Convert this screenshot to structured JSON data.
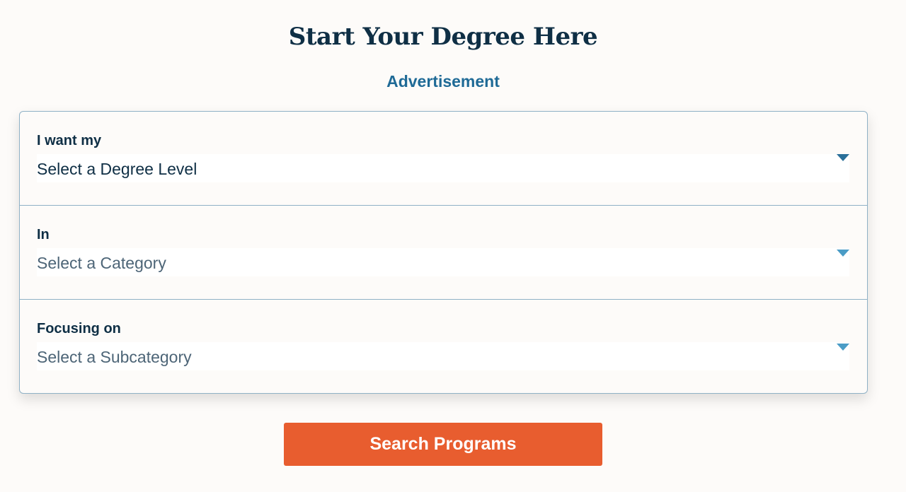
{
  "header": {
    "title": "Start Your Degree Here",
    "ad_label": "Advertisement"
  },
  "form": {
    "fields": [
      {
        "label": "I want my",
        "value": "Select a Degree Level",
        "state": "filled"
      },
      {
        "label": "In",
        "value": "Select a Category",
        "state": "placeholder"
      },
      {
        "label": "Focusing on",
        "value": "Select a Subcategory",
        "state": "placeholder"
      }
    ],
    "submit_label": "Search Programs"
  },
  "colors": {
    "background": "#fdfbf9",
    "heading": "#0f2f45",
    "accent": "#1f6a96",
    "button": "#e85d2f",
    "border": "#8fb1c6"
  }
}
